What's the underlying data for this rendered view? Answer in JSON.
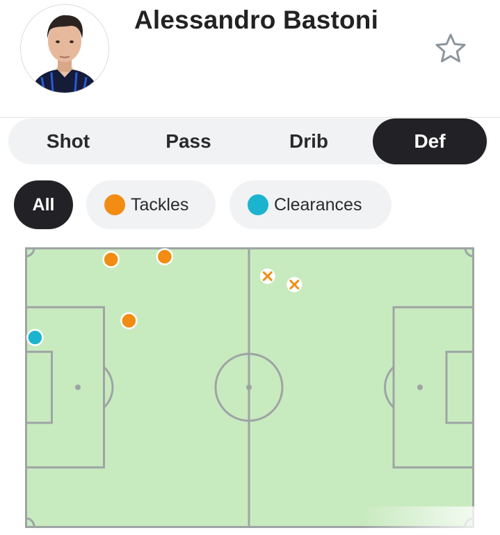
{
  "player": {
    "name": "Alessandro Bastoni",
    "avatar_icon": "player-photo",
    "favorite_icon": "star-outline-icon"
  },
  "tabs": [
    {
      "label": "Shot",
      "active": false
    },
    {
      "label": "Pass",
      "active": false
    },
    {
      "label": "Drib",
      "active": false
    },
    {
      "label": "Def",
      "active": true
    }
  ],
  "filters": [
    {
      "label": "All",
      "active": true
    },
    {
      "label": "Tackles",
      "active": false,
      "color": "#f28c13"
    },
    {
      "label": "Clearances",
      "active": false,
      "color": "#1cb3cf"
    }
  ],
  "colors": {
    "pitch": "#c8eabf",
    "lines": "#9ea4a4",
    "tackle": "#f28c13",
    "clearance": "#1cb3cf",
    "active_tab": "#222226",
    "inactive_bg": "#f1f2f4"
  },
  "actions": [
    {
      "type": "tackle",
      "result": "won",
      "x": 19,
      "y": 96
    },
    {
      "type": "tackle",
      "result": "won",
      "x": 31,
      "y": 97
    },
    {
      "type": "tackle",
      "result": "won",
      "x": 23,
      "y": 74
    },
    {
      "type": "clearance",
      "result": "won",
      "x": 2,
      "y": 68
    },
    {
      "type": "tackle",
      "result": "lost",
      "x": 54,
      "y": 90
    },
    {
      "type": "tackle",
      "result": "lost",
      "x": 60,
      "y": 87
    }
  ]
}
